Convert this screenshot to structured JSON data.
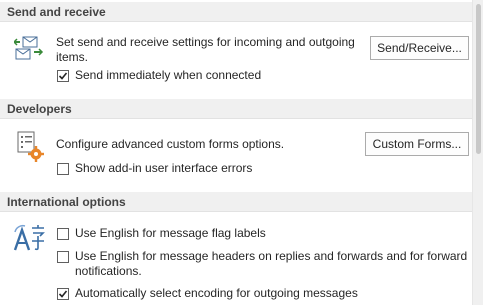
{
  "sections": {
    "send_receive": {
      "header": "Send and receive",
      "description_line1": "Set send and receive settings for incoming and outgoing",
      "description_line2": "items.",
      "button_label": "Send/Receive...",
      "checkbox_label": "Send immediately when connected",
      "checkbox_checked": true
    },
    "developers": {
      "header": "Developers",
      "description": "Configure advanced custom forms options.",
      "button_label": "Custom Forms...",
      "checkbox_label": "Show add-in user interface errors",
      "checkbox_checked": false
    },
    "international": {
      "header": "International options",
      "options": [
        {
          "label": "Use English for message flag labels",
          "checked": false
        },
        {
          "label_line1": "Use English for message headers on replies and forwards and for forward",
          "label_line2": "notifications.",
          "checked": false
        },
        {
          "label": "Automatically select encoding for outgoing messages",
          "checked": true
        }
      ]
    }
  },
  "icons": {
    "send_receive": "send-receive-icon",
    "developers": "custom-forms-gear-icon",
    "international": "language-translate-icon"
  },
  "colors": {
    "header_bg": "#f0f0f0",
    "header_text": "#444444",
    "gear_orange": "#e8862a",
    "icon_blue": "#3a6ea5"
  }
}
